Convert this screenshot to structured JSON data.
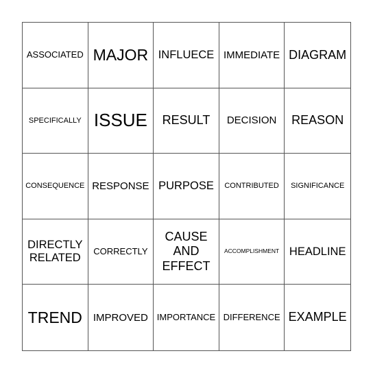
{
  "card": {
    "rows": [
      [
        "ASSOCIATED",
        "MAJOR",
        "INFLUECE",
        "IMMEDIATE",
        "DIAGRAM"
      ],
      [
        "SPECIFICALLY",
        "ISSUE",
        "RESULT",
        "DECISION",
        "REASON"
      ],
      [
        "CONSEQUENCE",
        "RESPONSE",
        "PURPOSE",
        "CONTRIBUTED",
        "SIGNIFICANCE"
      ],
      [
        "DIRECTLY RELATED",
        "CORRECTLY",
        "CAUSE AND EFFECT",
        "ACCOMPLISHMENT",
        "HEADLINE"
      ],
      [
        "TREND",
        "IMPROVED",
        "IMPORTANCE",
        "DIFFERENCE",
        "EXAMPLE"
      ]
    ],
    "line_color": "#555555",
    "text_color": "#000000",
    "background": "#ffffff"
  }
}
